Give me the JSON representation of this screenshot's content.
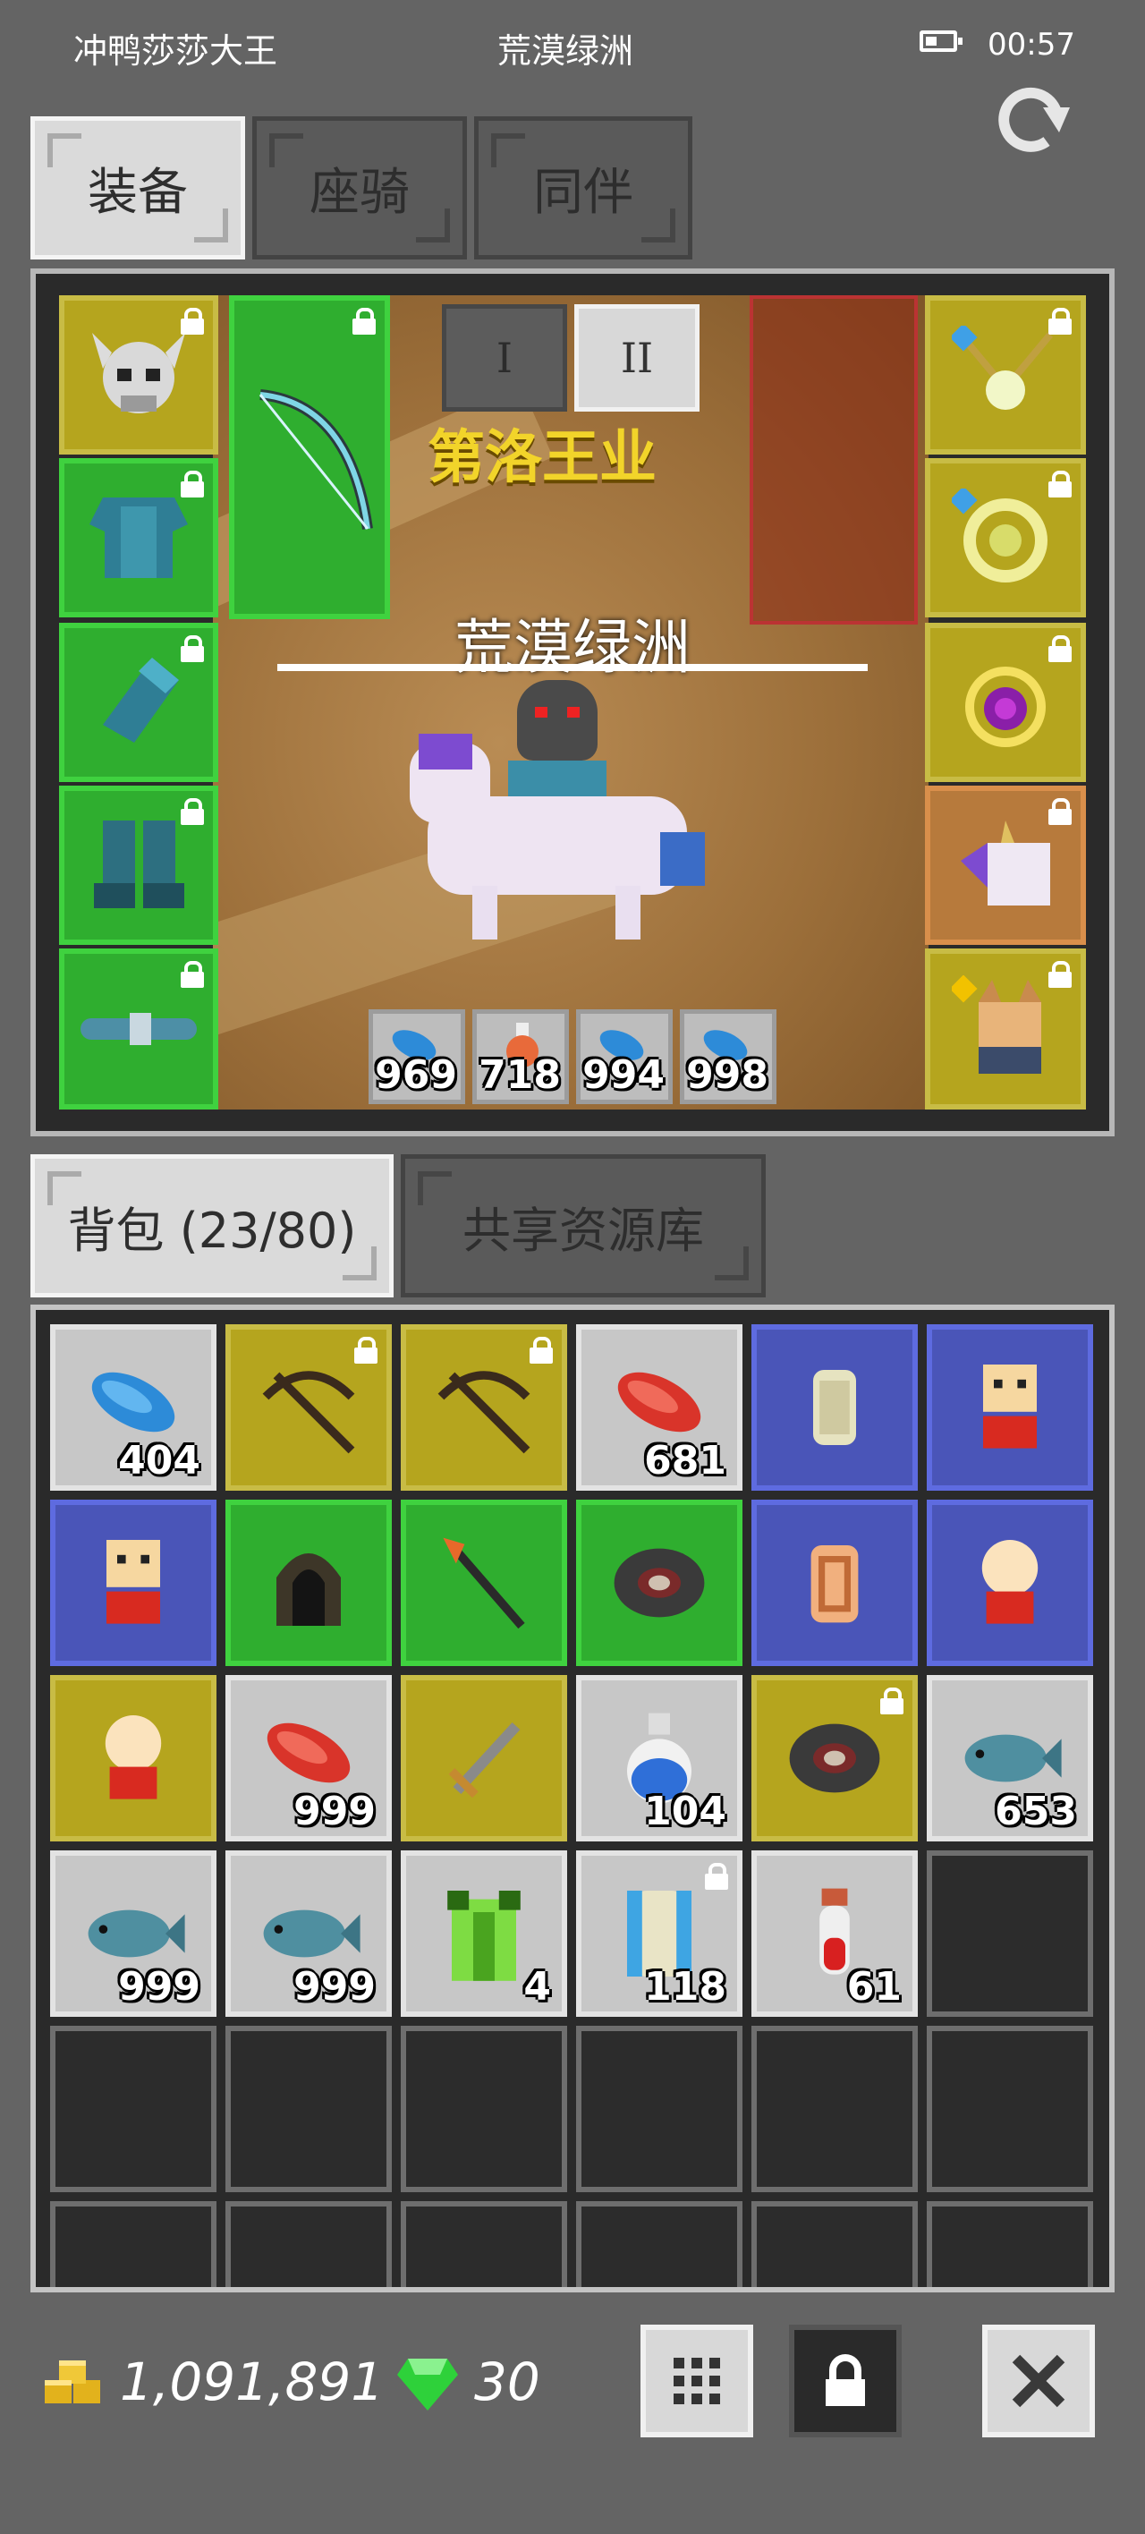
{
  "status_bar": {
    "player_name": "冲鸭莎莎大王",
    "location": "荒漠绿洲",
    "time": "00:57"
  },
  "top_tabs": [
    {
      "label": "装备",
      "active": true
    },
    {
      "label": "座骑",
      "active": false
    },
    {
      "label": "同伴",
      "active": false
    }
  ],
  "stage_tabs": [
    {
      "label": "I",
      "active": false
    },
    {
      "label": "II",
      "active": true
    }
  ],
  "scene": {
    "map_name": "荒漠绿洲",
    "guild_text": "第洛王业"
  },
  "equipment": {
    "left": [
      {
        "icon": "skull-helmet-icon",
        "color": "yellow",
        "locked": true
      },
      {
        "icon": "chest-armor-icon",
        "color": "green",
        "locked": true
      },
      {
        "icon": "gauntlet-icon",
        "color": "green",
        "locked": true
      },
      {
        "icon": "boots-icon",
        "color": "green",
        "locked": true
      },
      {
        "icon": "belt-icon",
        "color": "green",
        "locked": true
      }
    ],
    "weapon": {
      "icon": "bow-icon",
      "color": "green",
      "locked": true
    },
    "right": [
      {
        "icon": "necklace-icon",
        "color": "yellow",
        "locked": true
      },
      {
        "icon": "ring-icon",
        "color": "yellow",
        "locked": true
      },
      {
        "icon": "amulet-icon",
        "color": "yellow",
        "locked": true
      },
      {
        "icon": "mount-unicorn-icon",
        "color": "orange",
        "locked": true
      },
      {
        "icon": "pet-dog-icon",
        "color": "yellow",
        "locked": true
      }
    ]
  },
  "quick_items": [
    {
      "icon": "blue-feather-icon",
      "qty": "969"
    },
    {
      "icon": "potion-icon",
      "qty": "718"
    },
    {
      "icon": "blue-feather-icon",
      "qty": "994"
    },
    {
      "icon": "blue-feather-icon",
      "qty": "998"
    }
  ],
  "bag_tabs": [
    {
      "label": "背包 (23/80)",
      "active": true
    },
    {
      "label": "共享资源库",
      "active": false
    }
  ],
  "bag_items": [
    {
      "icon": "blue-feather-icon",
      "color": "gray",
      "qty": "404",
      "locked": false
    },
    {
      "icon": "crossbow-icon",
      "color": "yellow",
      "qty": "",
      "locked": true
    },
    {
      "icon": "crossbow-icon",
      "color": "yellow",
      "qty": "",
      "locked": true
    },
    {
      "icon": "red-feather-icon",
      "color": "gray",
      "qty": "681",
      "locked": false
    },
    {
      "icon": "scroll-icon",
      "color": "blue",
      "qty": "",
      "locked": false
    },
    {
      "icon": "npc-figure-icon",
      "color": "blue",
      "qty": "",
      "locked": false
    },
    {
      "icon": "npc-figure-icon",
      "color": "blue",
      "qty": "",
      "locked": false
    },
    {
      "icon": "hood-icon",
      "color": "green",
      "qty": "",
      "locked": false
    },
    {
      "icon": "staff-icon",
      "color": "green",
      "qty": "",
      "locked": false
    },
    {
      "icon": "gear-ring-icon",
      "color": "green",
      "qty": "",
      "locked": false
    },
    {
      "icon": "orange-scroll-icon",
      "color": "blue",
      "qty": "",
      "locked": false
    },
    {
      "icon": "chick-figure-icon",
      "color": "blue",
      "qty": "",
      "locked": false
    },
    {
      "icon": "chick-figure-icon",
      "color": "yellow",
      "qty": "",
      "locked": false
    },
    {
      "icon": "red-feather-icon",
      "color": "gray",
      "qty": "999",
      "locked": false
    },
    {
      "icon": "dagger-icon",
      "color": "yellow",
      "qty": "",
      "locked": false
    },
    {
      "icon": "blue-potion-icon",
      "color": "gray",
      "qty": "104",
      "locked": false
    },
    {
      "icon": "gear-ring-icon",
      "color": "yellow",
      "qty": "",
      "locked": true
    },
    {
      "icon": "fish-icon",
      "color": "gray",
      "qty": "653",
      "locked": false
    },
    {
      "icon": "fish-icon",
      "color": "gray",
      "qty": "999",
      "locked": false
    },
    {
      "icon": "fish-icon",
      "color": "gray",
      "qty": "999",
      "locked": false
    },
    {
      "icon": "green-vest-icon",
      "color": "gray",
      "qty": "4",
      "locked": false
    },
    {
      "icon": "blue-scroll-icon",
      "color": "gray",
      "qty": "118",
      "locked": true
    },
    {
      "icon": "red-potion-icon",
      "color": "gray",
      "qty": "61",
      "locked": false
    }
  ],
  "bottom_bar": {
    "gold": "1,091,891",
    "gems": "30"
  }
}
